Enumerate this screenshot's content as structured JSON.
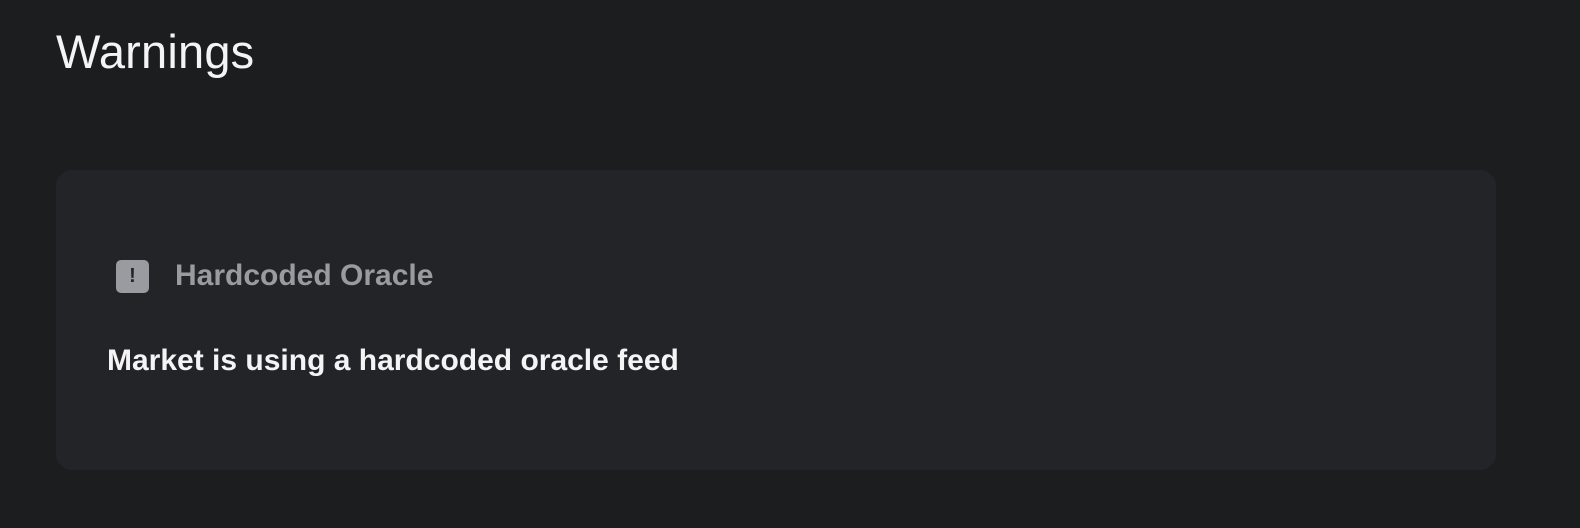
{
  "page": {
    "title": "Warnings"
  },
  "warnings": [
    {
      "icon": "exclamation-icon",
      "icon_glyph": "!",
      "title": "Hardcoded Oracle",
      "message": "Market is using a hardcoded oracle feed"
    }
  ],
  "colors": {
    "background": "#1c1d1f",
    "card": "#232428",
    "muted": "#9a9ba0",
    "text": "#f4f4f5"
  }
}
